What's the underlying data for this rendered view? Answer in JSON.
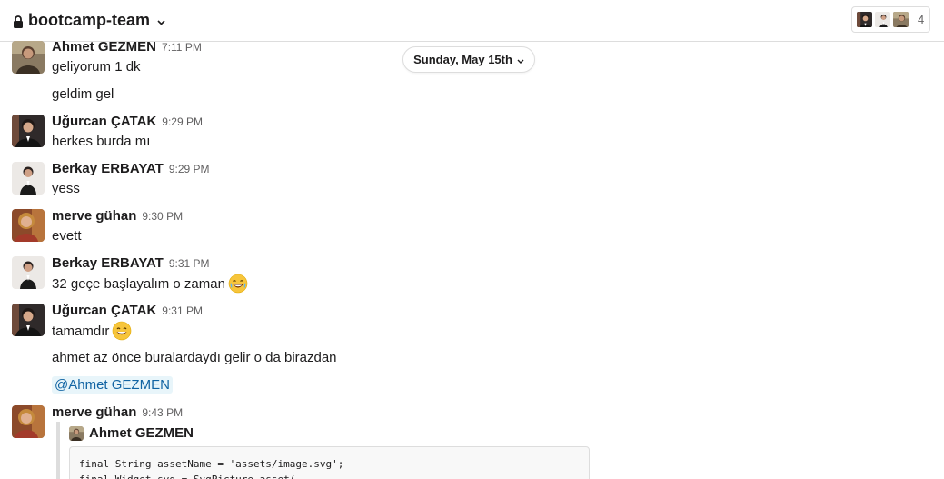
{
  "header": {
    "channel_name": "bootcamp-team",
    "member_count": "4"
  },
  "date_divider": {
    "label": "Sunday, May 15th"
  },
  "messages": [
    {
      "author": "Ahmet GEZMEN",
      "time": "7:11 PM",
      "lines": [
        "geliyorum 1 dk",
        "geldim gel"
      ]
    },
    {
      "author": "Uğurcan ÇATAK",
      "time": "9:29 PM",
      "lines": [
        "herkes burda mı"
      ]
    },
    {
      "author": "Berkay ERBAYAT",
      "time": "9:29 PM",
      "lines": [
        "yess"
      ]
    },
    {
      "author": "merve gühan",
      "time": "9:30 PM",
      "lines": [
        "evett"
      ]
    },
    {
      "author": "Berkay ERBAYAT",
      "time": "9:31 PM",
      "lines": [
        "32 geçe başlayalım o zaman"
      ]
    },
    {
      "author": "Uğurcan ÇATAK",
      "time": "9:31 PM",
      "lines": [
        "tamamdır",
        "ahmet az önce buralardaydı gelir o da birazdan",
        "@Ahmet GEZMEN"
      ]
    },
    {
      "author": "merve gühan",
      "time": "9:43 PM",
      "lines": []
    }
  ],
  "quote": {
    "author": "Ahmet GEZMEN",
    "code_line_1": "final String assetName = 'assets/image.svg';",
    "code_line_2": "final Widget svg = SvgPicture.asset("
  },
  "emojis": [
    "laughing-tears-icon",
    "grinning-face-icon"
  ],
  "colors": {
    "mention_bg": "#e8f5fa",
    "mention_text": "#1264a3",
    "muted_text": "#616061",
    "border": "#dddddd"
  }
}
